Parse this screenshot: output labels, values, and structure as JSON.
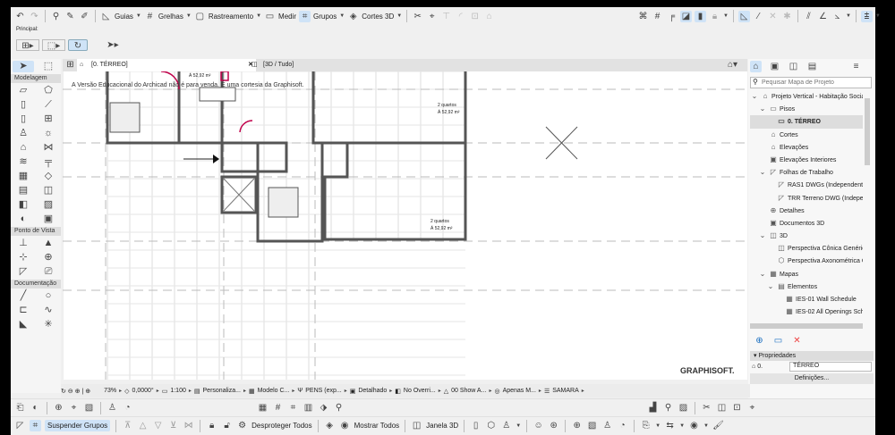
{
  "toolbar": {
    "guides": "Guias",
    "grids": "Grelhas",
    "tracking": "Rastreamento",
    "measure": "Medir",
    "groups": "Grupos",
    "sections3d": "Cortes 3D",
    "principal": "Principal:"
  },
  "toolbox": {
    "modeling": "Modelagem",
    "viewpoint": "Ponto de Vista",
    "documentation": "Documentação"
  },
  "tabs": [
    {
      "label": "[0. TÉRREO]",
      "active": true
    },
    {
      "label": "[3D / Tudo]",
      "active": false
    }
  ],
  "canvas": {
    "watermark": "A Versão Educacional do Archicad não é para venda. É uma cortesia da Graphisoft.",
    "logo": "GRAPHISOFT.",
    "room_label_1": "2 quartos",
    "room_area_1": "Á 52,92 m²",
    "room_label_2": "2 quartos",
    "room_area_2": "Á 52,92 m²",
    "small_area": "Á 52,92 m²"
  },
  "panel": {
    "search_placeholder": "Pequisar Mapa de Projeto",
    "tree": [
      {
        "label": "Projeto Vertical - Habitação Social",
        "icon": "project-icon",
        "level": 0,
        "expander": "v"
      },
      {
        "label": "Pisos",
        "icon": "folder-icon",
        "level": 1,
        "expander": "v"
      },
      {
        "label": "0. TÉRREO",
        "icon": "story-icon",
        "level": 2,
        "expander": "",
        "selected": true
      },
      {
        "label": "Cortes",
        "icon": "section-icon",
        "level": 1,
        "expander": ""
      },
      {
        "label": "Elevações",
        "icon": "elevation-icon",
        "level": 1,
        "expander": ""
      },
      {
        "label": "Elevações Interiores",
        "icon": "interior-elevation-icon",
        "level": 1,
        "expander": ""
      },
      {
        "label": "Folhas de Trabalho",
        "icon": "worksheet-icon",
        "level": 1,
        "expander": "v"
      },
      {
        "label": "RAS1 DWGs (Independente)",
        "icon": "worksheet-icon",
        "level": 2,
        "expander": ""
      },
      {
        "label": "TRR Terreno DWG (Independente)",
        "icon": "worksheet-icon",
        "level": 2,
        "expander": ""
      },
      {
        "label": "Detalhes",
        "icon": "detail-icon",
        "level": 1,
        "expander": ""
      },
      {
        "label": "Documentos 3D",
        "icon": "document3d-icon",
        "level": 1,
        "expander": ""
      },
      {
        "label": "3D",
        "icon": "3d-icon",
        "level": 1,
        "expander": "v"
      },
      {
        "label": "Perspectiva Cônica Genérica",
        "icon": "perspective-icon",
        "level": 2,
        "expander": ""
      },
      {
        "label": "Perspectiva Axonométrica Genérica",
        "icon": "axonometric-icon",
        "level": 2,
        "expander": ""
      },
      {
        "label": "Mapas",
        "icon": "schedule-icon",
        "level": 1,
        "expander": "v"
      },
      {
        "label": "Elementos",
        "icon": "elements-icon",
        "level": 2,
        "expander": "v"
      },
      {
        "label": "IES-01 Wall Schedule",
        "icon": "schedule-icon",
        "level": 3,
        "expander": ""
      },
      {
        "label": "IES-02 All Openings Schedule",
        "icon": "schedule-icon",
        "level": 3,
        "expander": ""
      }
    ],
    "properties": "Propriedades",
    "story_num": "0.",
    "story_name": "TÉRREO",
    "settings": "Definições..."
  },
  "status": {
    "zoom": "73%",
    "angle": "0,0000°",
    "scale": "1:100",
    "layer": "Personaliza...",
    "model": "Modelo C...",
    "pen": "PENS (exp...",
    "detail": "Detalhado",
    "override": "No Overri...",
    "show": "00 Show A...",
    "only": "Apenas M...",
    "renovation": "SAMARA"
  },
  "bottom": {
    "suspend_groups": "Suspender Grupos",
    "unlock_all": "Desproteger Todos",
    "show_all": "Mostrar Todos",
    "window3d": "Janela 3D"
  }
}
